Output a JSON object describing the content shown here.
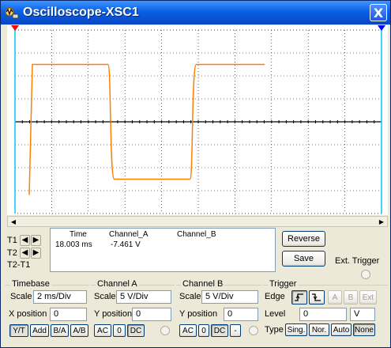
{
  "window": {
    "title": "Oscilloscope-XSC1",
    "close_glyph": "X"
  },
  "colors": {
    "trace_a": "#ff8000",
    "cursor_line": "#00c8ff",
    "grid": "#000000",
    "title_bar": "#0a5fe4"
  },
  "cursors": {
    "t1_label": "T1",
    "t2_label": "T2",
    "diff_label": "T2-T1",
    "t1_marker_color": "#ff0000",
    "t2_marker_color": "#0000ff"
  },
  "readout": {
    "headers": [
      "Time",
      "Channel_A",
      "Channel_B"
    ],
    "row": {
      "time": "18.003 ms",
      "channel_a": "-7.461  V",
      "channel_b": ""
    }
  },
  "buttons": {
    "reverse": "Reverse",
    "save": "Save",
    "ext_trigger": "Ext. Trigger"
  },
  "timebase": {
    "title": "Timebase",
    "scale_label": "Scale",
    "scale_value": "2 ms/Div",
    "xpos_label": "X position",
    "xpos_value": "0",
    "modes": [
      "Y/T",
      "Add",
      "B/A",
      "A/B"
    ]
  },
  "channel_a": {
    "title": "Channel A",
    "scale_label": "Scale",
    "scale_value": "5  V/Div",
    "ypos_label": "Y position",
    "ypos_value": "0",
    "coupling": [
      "AC",
      "0",
      "DC"
    ]
  },
  "channel_b": {
    "title": "Channel B",
    "scale_label": "Scale",
    "scale_value": "5  V/Div",
    "ypos_label": "Y  position",
    "ypos_value": "0",
    "coupling": [
      "AC",
      "0",
      "DC",
      "-"
    ]
  },
  "trigger": {
    "title": "Trigger",
    "edge_label": "Edge",
    "edge_buttons": [
      "rising-edge",
      "falling-edge",
      "A",
      "B",
      "Ext"
    ],
    "level_label": "Level",
    "level_value": "0",
    "level_unit": "V",
    "type_label": "Type",
    "types": [
      "Sing.",
      "Nor.",
      "Auto",
      "None"
    ]
  },
  "waveform": {
    "channel": "A",
    "shape": "square",
    "high_v": 12.5,
    "low_v": -12.5,
    "period_ms": 8.6,
    "time_per_div_ms": 2,
    "volts_per_div": 5,
    "h_divisions": 10,
    "v_divisions": 8
  }
}
